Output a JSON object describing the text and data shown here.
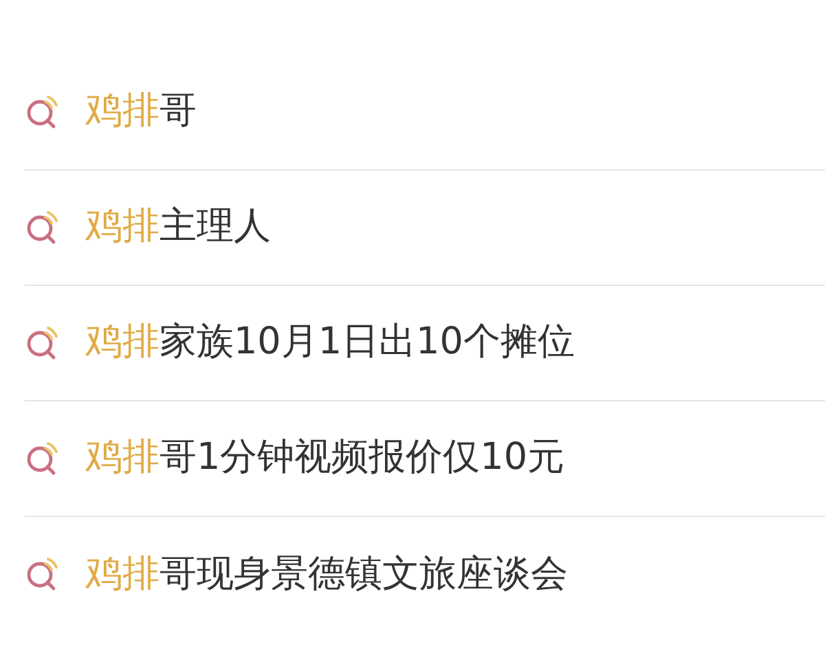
{
  "suggestions": [
    {
      "match": "鸡排",
      "rest": "哥"
    },
    {
      "match": "鸡排",
      "rest": "主理人"
    },
    {
      "match": "鸡排",
      "rest": "家族10月1日出10个摊位"
    },
    {
      "match": "鸡排",
      "rest": "哥1分钟视频报价仅10元"
    },
    {
      "match": "鸡排",
      "rest": "哥现身景德镇文旅座谈会"
    }
  ]
}
